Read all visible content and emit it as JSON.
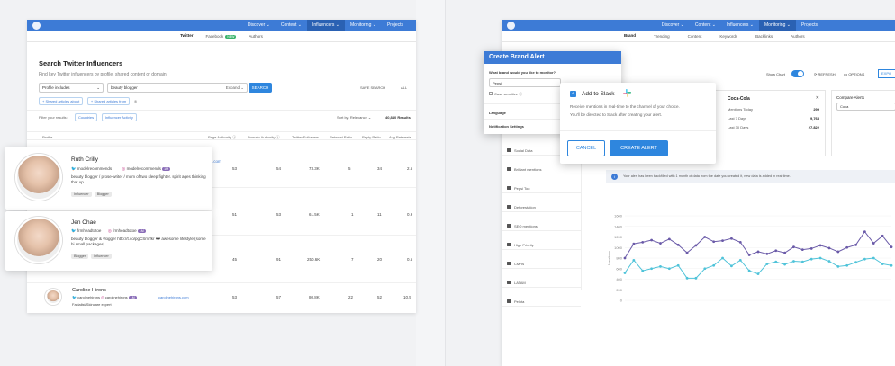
{
  "left": {
    "nav": [
      "Discover ⌄",
      "Content ⌄",
      "Influencers ⌄",
      "Monitoring ⌄",
      "Projects"
    ],
    "nav_active_index": 2,
    "tabs": [
      "Twitter",
      "Facebook",
      "Authors"
    ],
    "tabs_new_badge": "NEW",
    "title": "Search Twitter Influencers",
    "subtitle": "Find key Twitter influencers by profile, shared content or domain",
    "filter_select": "Profile includes",
    "search_value": "beauty blogger",
    "expand_label": "Expand ⌄",
    "search_button": "SEARCH",
    "save_search": "SAVE SEARCH",
    "all_label": "ALL",
    "chips": [
      "+ Shared articles about",
      "+ Shared articles from"
    ],
    "filter_label": "Filter your results:",
    "filter_chips": [
      "Countries",
      "Influencer Activity"
    ],
    "sort_label": "Sort by: Relevance ⌄",
    "results_count": "40,840 Results",
    "columns": [
      "Profile",
      "Page Authority ⓘ",
      "Domain Authority ⓘ",
      "Twitter Followers",
      "Retweet Ratio",
      "Reply Ratio",
      "Avg Retweets"
    ],
    "rows": [
      {
        "site": ".com",
        "pa": "53",
        "da": "54",
        "followers": "73.3K",
        "rt": "5",
        "reply": "34",
        "avg": "2.5"
      },
      {
        "site": "",
        "pa": "51",
        "da": "53",
        "followers": "61.5K",
        "rt": "1",
        "reply": "11",
        "avg": "0.9"
      },
      {
        "site": "",
        "pa": "45",
        "da": "91",
        "followers": "250.6K",
        "rt": "7",
        "reply": "20",
        "avg": "0.5"
      },
      {
        "site": "carolinehirons.com",
        "pa": "53",
        "da": "57",
        "followers": "80.8K",
        "rt": "22",
        "reply": "52",
        "avg": "10.5"
      }
    ],
    "caroline": {
      "name": "Caroline Hirons",
      "twitter": "carolinehirons",
      "instagram": "carolinehirons",
      "ig_count": "1M",
      "bio": "Facialist/Skincare expert"
    },
    "cards": [
      {
        "name": "Ruth Crilly",
        "twitter": "modelrecommends",
        "instagram": "modelrecommends",
        "ig_count": "1M",
        "bio": "beauty blogger / prose-writer / mum of two sleep fighter. spirit ages thinking that up.",
        "tags": [
          "Influencer",
          "Blogger"
        ]
      },
      {
        "name": "Jen Chae",
        "twitter": "frmheadtotoe",
        "instagram": "frmheadtotoe",
        "ig_count": "1M",
        "bio": "beauty blogger & vlogger http://t.co/pgCSmrfkr ♥♥ awesome lifestyle (some hi small packages)",
        "tags": [
          "Blogger",
          "Influencer"
        ]
      }
    ],
    "under_tags": [
      "Blogger",
      "Influencer"
    ]
  },
  "right": {
    "nav": [
      "Discover ⌄",
      "Content ⌄",
      "Influencers ⌄",
      "Monitoring ⌄",
      "Projects"
    ],
    "nav_active_index": 3,
    "tabs": [
      "Brand",
      "Trending",
      "Content",
      "Keywords",
      "Backlinks",
      "Authors"
    ],
    "show_chart": "Show Chart",
    "refresh": "⟳ REFRESH",
    "options": "••• OPTIONS",
    "export": "EXPO",
    "modal": {
      "title": "Create Brand Alert",
      "question": "What brand would you like to monitor?",
      "input_value": "Pepsi",
      "case_sensitive": "Case sensitive ⓘ",
      "language": "Language",
      "notification": "Notification Settings"
    },
    "slack": {
      "label": "Add to Slack",
      "text1": "Receive mentions in real-time to the channel of your choice.",
      "text2": "You'll be directed to Slack after creating your alert.",
      "cancel": "CANCEL",
      "create": "CREATE ALERT"
    },
    "stats": {
      "brand": "Coca-Cola",
      "close": "✕",
      "rows": [
        {
          "label": "Mentions Today",
          "value": "299"
        },
        {
          "label": "Last 7 Days",
          "value": "9,768"
        },
        {
          "label": "Last 30 Days",
          "value": "27,822"
        }
      ]
    },
    "compare": {
      "title": "Compare Alerts",
      "value": "Coca"
    },
    "notice": "Your alert has been backfilled with 1 month of data from the date you created it, new data is added in real time.",
    "sidebar": [
      "Social Data",
      "Brilliant mentions",
      "Pepsi Too",
      "Deforestation",
      "SEO mentions",
      "High Priority",
      "CMRs",
      "LATAM",
      "Pelota"
    ],
    "chart_data": {
      "type": "line",
      "ylabel": "Mentions",
      "ylim": [
        0,
        1600
      ],
      "yticks": [
        0,
        200,
        400,
        600,
        800,
        1000,
        1200,
        1400,
        1600
      ],
      "x": [
        "01",
        "02",
        "03",
        "04",
        "05",
        "06",
        "07",
        "08",
        "09",
        "10",
        "11",
        "12",
        "13",
        "14",
        "15",
        "16",
        "17",
        "18",
        "19",
        "20",
        "21",
        "22",
        "23",
        "24",
        "25",
        "26",
        "27",
        "28",
        "29",
        "30",
        "31"
      ],
      "series": [
        {
          "color": "#6a5aa8",
          "values": [
            800,
            1070,
            1100,
            1140,
            1080,
            1160,
            1050,
            900,
            1040,
            1200,
            1110,
            1130,
            1170,
            1100,
            860,
            920,
            880,
            940,
            900,
            1010,
            960,
            980,
            1040,
            990,
            920,
            1000,
            1050,
            1300,
            1080,
            1220,
            1010
          ]
        },
        {
          "color": "#4fc3d9",
          "values": [
            520,
            760,
            560,
            600,
            640,
            600,
            660,
            420,
            420,
            600,
            660,
            800,
            650,
            760,
            560,
            500,
            690,
            730,
            680,
            740,
            730,
            780,
            800,
            740,
            640,
            660,
            720,
            780,
            800,
            690,
            660
          ]
        }
      ]
    }
  }
}
